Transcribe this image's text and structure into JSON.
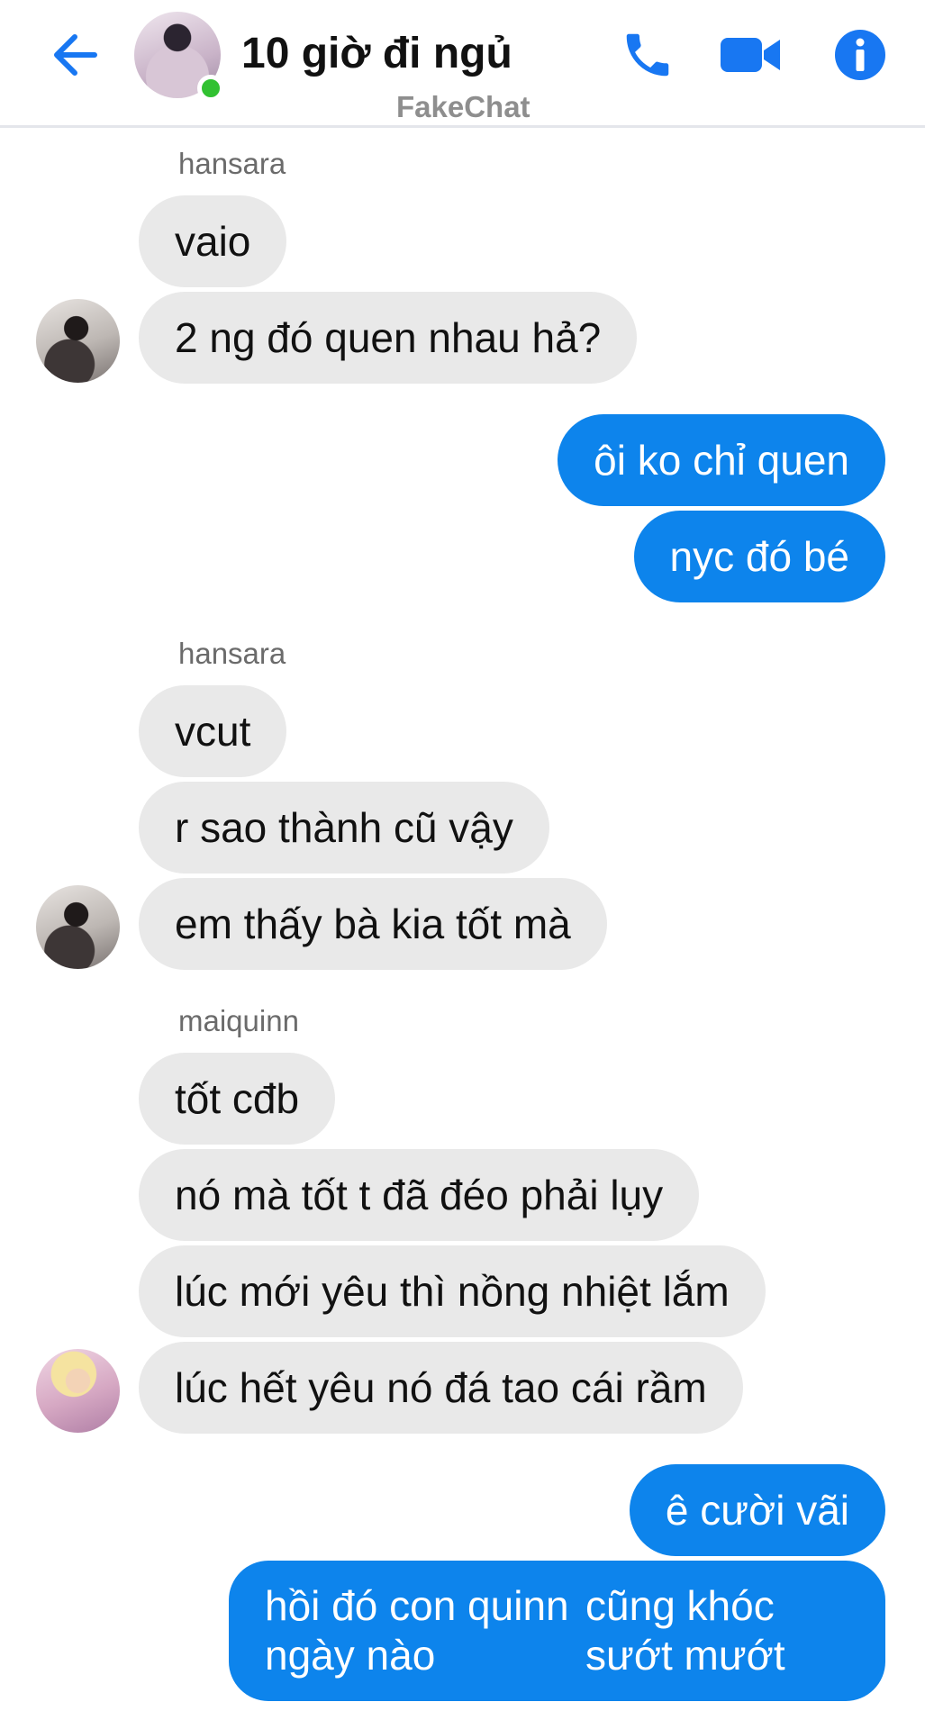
{
  "header": {
    "title": "10 giờ đi ngủ",
    "subtitle": "FakeChat",
    "back_icon": "arrow-left-icon",
    "call_icon": "phone-icon",
    "video_icon": "video-camera-icon",
    "info_icon": "info-icon",
    "accent_color": "#1877f2",
    "online_color": "#31c131"
  },
  "messages": {
    "group1": {
      "sender": "hansara",
      "m1": "vaio",
      "m2": "2 ng đó quen nhau hả?"
    },
    "group2": {
      "m1": "ôi ko chỉ quen",
      "m2": "nyc đó bé"
    },
    "group3": {
      "sender": "hansara",
      "m1": "vcut",
      "m2": "r sao thành cũ vậy",
      "m3": "em thấy bà kia tốt mà"
    },
    "group4": {
      "sender": "maiquinn",
      "m1": "tốt cđb",
      "m2": "nó mà tốt t đã đéo phải lụy",
      "m3": "lúc mới yêu thì nồng nhiệt lắm",
      "m4": "lúc hết yêu nó đá tao cái rầm"
    },
    "group5": {
      "m1": "ê cười vãi",
      "m2_line1": "hồi đó con quinn ngày nào",
      "m2_line2": "cũng khóc sướt mướt"
    }
  },
  "colors": {
    "incoming_bubble": "#e9e9e9",
    "outgoing_bubble": "#0d84ec"
  }
}
